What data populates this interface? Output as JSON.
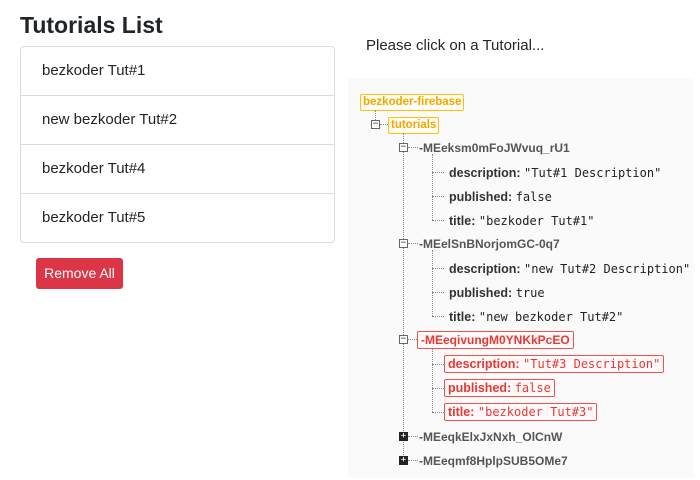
{
  "tutorials_list": {
    "title": "Tutorials List",
    "items": [
      "bezkoder Tut#1",
      "new bezkoder Tut#2",
      "bezkoder Tut#4",
      "bezkoder Tut#5"
    ],
    "remove_all_label": "Remove All"
  },
  "details": {
    "hint": "Please click on a Tutorial..."
  },
  "tree": {
    "root": "bezkoder-firebase",
    "collection": "tutorials",
    "records": [
      {
        "id": "-MEeksm0mFoJWvuq_rU1",
        "expanded": true,
        "highlight": false,
        "fields": [
          {
            "key": "description:",
            "value": "\"Tut#1 Description\""
          },
          {
            "key": "published:",
            "value": "false"
          },
          {
            "key": "title:",
            "value": "\"bezkoder Tut#1\""
          }
        ]
      },
      {
        "id": "-MEelSnBNorjomGC-0q7",
        "expanded": true,
        "highlight": false,
        "fields": [
          {
            "key": "description:",
            "value": "\"new Tut#2 Description\""
          },
          {
            "key": "published:",
            "value": "true"
          },
          {
            "key": "title:",
            "value": "\"new bezkoder Tut#2\""
          }
        ]
      },
      {
        "id": "-MEeqivungM0YNKkPcEO",
        "expanded": true,
        "highlight": true,
        "fields": [
          {
            "key": "description:",
            "value": "\"Tut#3 Description\""
          },
          {
            "key": "published:",
            "value": "false"
          },
          {
            "key": "title:",
            "value": "\"bezkoder Tut#3\""
          }
        ]
      },
      {
        "id": "-MEeqkElxJxNxh_OlCnW",
        "expanded": false,
        "highlight": false,
        "fields": []
      },
      {
        "id": "-MEeqmf8HplpSUB5OMe7",
        "expanded": false,
        "highlight": false,
        "fields": []
      }
    ]
  },
  "colors": {
    "danger": "#dc3545",
    "root_badge": "#ffc107",
    "deleted_highlight": "#e53935"
  },
  "icons": {
    "expanded": "minus-toggle-icon",
    "collapsed": "plus-toggle-icon"
  }
}
